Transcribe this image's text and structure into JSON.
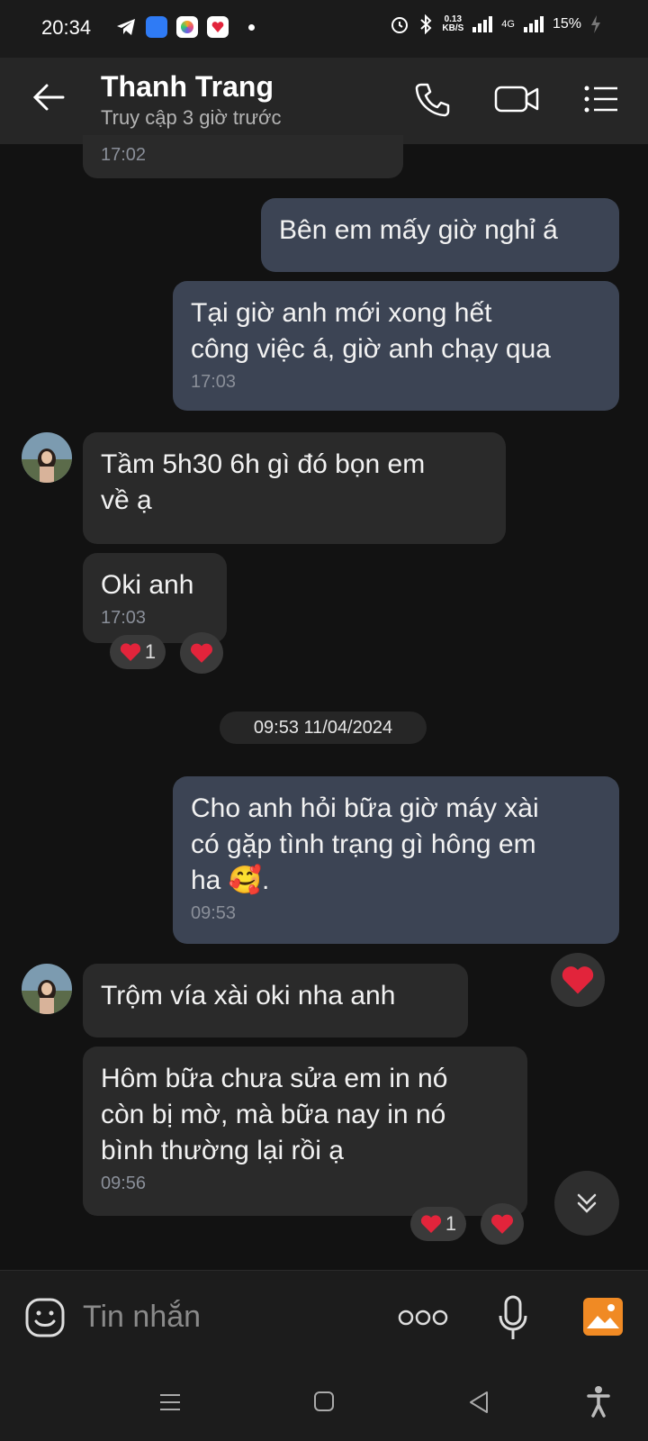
{
  "status": {
    "time": "20:34",
    "net_speed_top": "0.13",
    "net_speed_bottom": "KB/S",
    "network": "4G",
    "battery": "15%"
  },
  "header": {
    "name": "Thanh Trang",
    "subtitle": "Truy cập 3 giờ trước"
  },
  "messages": {
    "m0_time": "17:02",
    "m1_text": "Bên em mấy giờ nghỉ á",
    "m2_line1": "Tại giờ anh mới xong hết",
    "m2_line2": "công việc á, giờ anh chạy qua",
    "m2_time": "17:03",
    "m3_line1": "Tầm 5h30 6h gì đó bọn em",
    "m3_line2": "về ạ",
    "m4_text": "Oki anh",
    "m4_time": "17:03",
    "m4_react_count": "1",
    "date_separator": "09:53 11/04/2024",
    "m5_line1": "Cho anh hỏi bữa giờ máy xài",
    "m5_line2": "có gặp tình trạng gì hông em",
    "m5_line3": "ha 🥰.",
    "m5_time": "09:53",
    "m6_text": "Trộm vía xài oki nha anh",
    "m7_line1": "Hôm bữa chưa sửa em in nó",
    "m7_line2": "còn bị mờ, mà bữa nay in nó",
    "m7_line3": "bình thường lại rồi ạ",
    "m7_time": "09:56",
    "m7_react_count": "1"
  },
  "input": {
    "placeholder": "Tin nhắn"
  },
  "colors": {
    "accent_icon": "#f08a24",
    "heart": "#e2243b",
    "outgoing_bubble": "#3c4454"
  }
}
